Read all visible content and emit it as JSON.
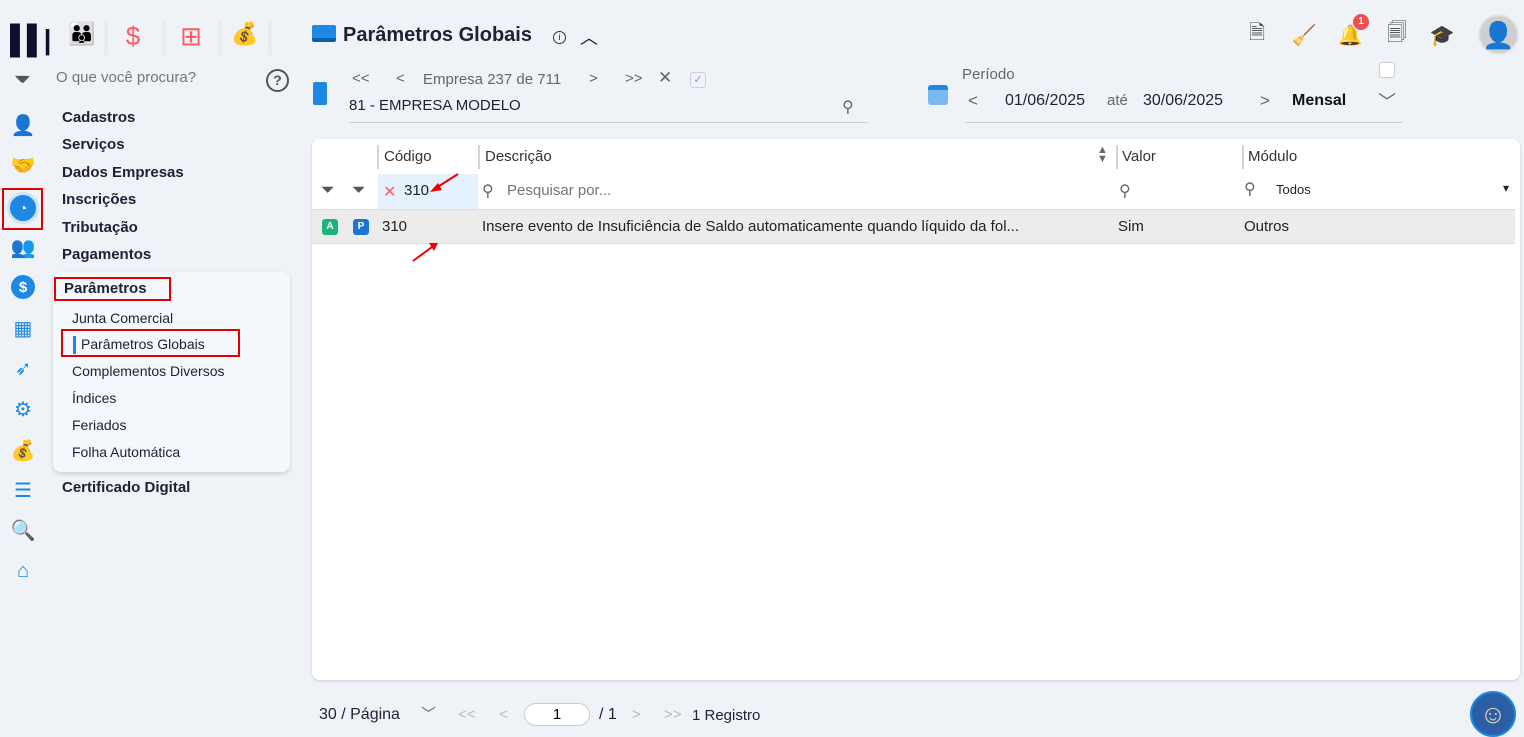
{
  "top_apps": [
    {
      "name": "people"
    },
    {
      "name": "dollar"
    },
    {
      "name": "calculator"
    },
    {
      "name": "money-bag"
    }
  ],
  "search": {
    "placeholder": "O que você procura?"
  },
  "menu": {
    "items": [
      "Cadastros",
      "Serviços",
      "Dados Empresas",
      "Inscrições",
      "Tributação",
      "Pagamentos"
    ],
    "open_group": "Parâmetros",
    "sub_items": [
      "Junta Comercial",
      "Parâmetros Globais",
      "Complementos Diversos",
      "Índices",
      "Feriados",
      "Folha Automática"
    ],
    "after": "Certificado Digital"
  },
  "header": {
    "title": "Parâmetros Globais",
    "notification_count": "1"
  },
  "company": {
    "label": "Empresa",
    "current": "237",
    "of": "de",
    "total": "711",
    "name": "81 - EMPRESA MODELO"
  },
  "period": {
    "label": "Período",
    "start": "01/06/2025",
    "sep": "até",
    "end": "30/06/2025",
    "type": "Mensal"
  },
  "table": {
    "columns": [
      "Código",
      "Descrição",
      "Valor",
      "Módulo"
    ],
    "filters": {
      "codigo": "310",
      "descricao_placeholder": "Pesquisar por...",
      "modulo": "Todos"
    },
    "rows": [
      {
        "badge1": "A",
        "badge2": "P",
        "codigo": "310",
        "descricao": "Insere evento de Insuficiência de Saldo automaticamente quando líquido da fol...",
        "valor": "Sim",
        "modulo": "Outros"
      }
    ]
  },
  "footer": {
    "per_page": "30 / Página",
    "page": "1",
    "total_pages": "/ 1",
    "records": "1 Registro"
  },
  "colors": {
    "accent": "#1e88e5",
    "red": "#ff5a5f",
    "badge_a": "#1bb57a",
    "badge_p": "#1976d2"
  }
}
